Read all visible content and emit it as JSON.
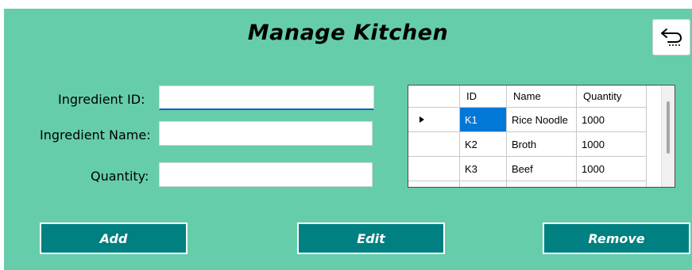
{
  "window": {
    "title": "Manage Kitchen",
    "background_color": "#66cdaa"
  },
  "header": {
    "back_icon": "return-arrow-icon"
  },
  "form": {
    "ingredient_id": {
      "label": "Ingredient ID:",
      "value": "",
      "placeholder": ""
    },
    "ingredient_name": {
      "label": "Ingredient Name:",
      "value": "",
      "placeholder": ""
    },
    "quantity": {
      "label": "Quantity:",
      "value": "",
      "placeholder": ""
    }
  },
  "grid": {
    "columns": [
      "ID",
      "Name",
      "Quantity"
    ],
    "rows": [
      {
        "id": "K1",
        "name": "Rice Noodle",
        "quantity": "1000",
        "current": true
      },
      {
        "id": "K2",
        "name": "Broth",
        "quantity": "1000",
        "current": false
      },
      {
        "id": "K3",
        "name": "Beef",
        "quantity": "1000",
        "current": false
      }
    ],
    "current_row_icon": "row-pointer-triangle-icon",
    "selection_color": "#0078d7"
  },
  "actions": {
    "add_label": "Add",
    "edit_label": "Edit",
    "remove_label": "Remove",
    "button_color": "#008080"
  }
}
